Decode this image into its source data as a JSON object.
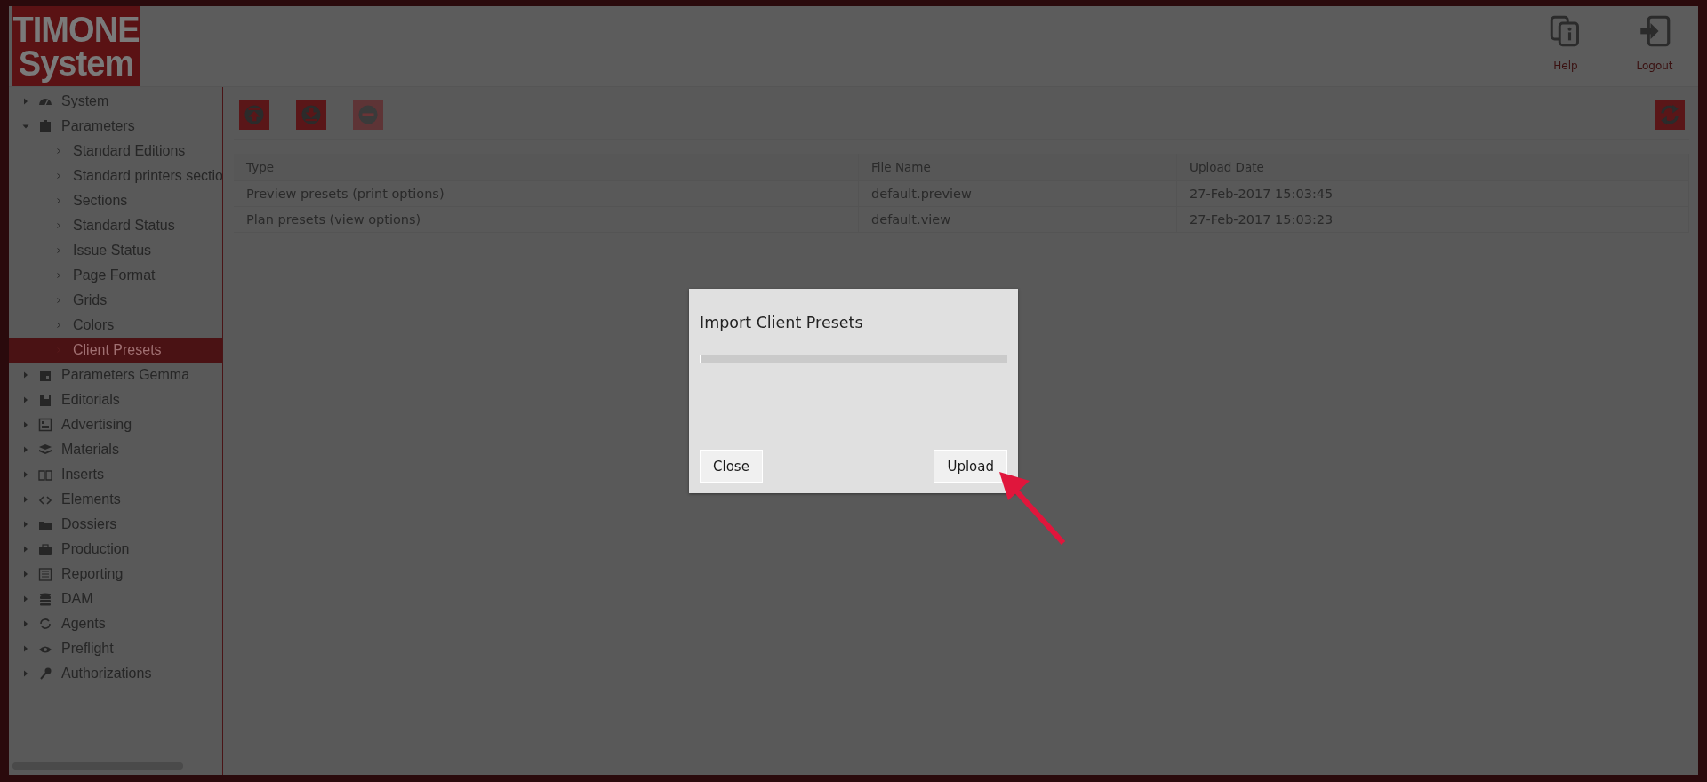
{
  "logo": {
    "line_1": "TIMONE",
    "line_2": "System"
  },
  "header_actions": [
    {
      "label": "Help"
    },
    {
      "label": "Logout"
    }
  ],
  "sidebar": {
    "items": [
      {
        "label": "System",
        "expanded": false,
        "selected": false
      },
      {
        "label": "Parameters",
        "expanded": true,
        "selected": false,
        "children": [
          {
            "label": "Standard Editions",
            "selected": false
          },
          {
            "label": "Standard printers sectio",
            "selected": false
          },
          {
            "label": "Sections",
            "selected": false
          },
          {
            "label": "Standard Status",
            "selected": false
          },
          {
            "label": "Issue Status",
            "selected": false
          },
          {
            "label": "Page Format",
            "selected": false
          },
          {
            "label": "Grids",
            "selected": false
          },
          {
            "label": "Colors",
            "selected": false
          },
          {
            "label": "Client Presets",
            "selected": true
          }
        ]
      },
      {
        "label": "Parameters Gemma",
        "expanded": false,
        "selected": false
      },
      {
        "label": "Editorials",
        "expanded": false,
        "selected": false
      },
      {
        "label": "Advertising",
        "expanded": false,
        "selected": false
      },
      {
        "label": "Materials",
        "expanded": false,
        "selected": false
      },
      {
        "label": "Inserts",
        "expanded": false,
        "selected": false
      },
      {
        "label": "Elements",
        "expanded": false,
        "selected": false
      },
      {
        "label": "Dossiers",
        "expanded": false,
        "selected": false
      },
      {
        "label": "Production",
        "expanded": false,
        "selected": false
      },
      {
        "label": "Reporting",
        "expanded": false,
        "selected": false
      },
      {
        "label": "DAM",
        "expanded": false,
        "selected": false
      },
      {
        "label": "Agents",
        "expanded": false,
        "selected": false
      },
      {
        "label": "Preflight",
        "expanded": false,
        "selected": false
      },
      {
        "label": "Authorizations",
        "expanded": false,
        "selected": false
      }
    ]
  },
  "toolbar": {
    "buttons": [
      {
        "kind": "upload",
        "disabled": false
      },
      {
        "kind": "download",
        "disabled": false
      },
      {
        "kind": "remove",
        "disabled": true
      }
    ]
  },
  "table": {
    "columns": [
      "Type",
      "File Name",
      "Upload Date"
    ],
    "rows": [
      [
        "Preview presets (print options)",
        "default.preview",
        "27-Feb-2017 15:03:45"
      ],
      [
        "Plan presets (view options)",
        "default.view",
        "27-Feb-2017 15:03:23"
      ]
    ]
  },
  "dialog": {
    "title": "Import Client Presets",
    "progress": {
      "level": 0.005
    },
    "buttons": [
      "Close",
      "Upload"
    ]
  }
}
